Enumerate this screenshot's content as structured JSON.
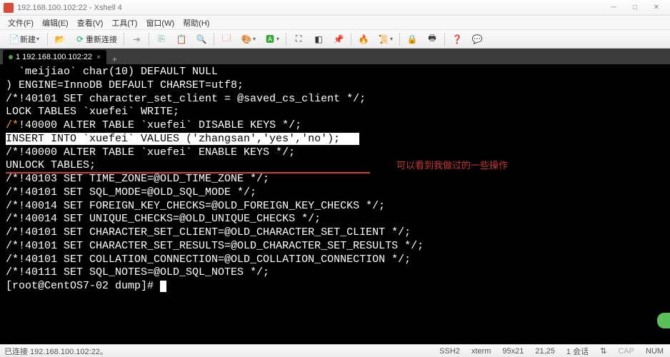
{
  "titlebar": {
    "text": "192.168.100.102:22 - Xshell 4"
  },
  "menubar": [
    {
      "label": "文件(F)"
    },
    {
      "label": "编辑(E)"
    },
    {
      "label": "查看(V)"
    },
    {
      "label": "工具(T)"
    },
    {
      "label": "窗口(W)"
    },
    {
      "label": "帮助(H)"
    }
  ],
  "toolbar": {
    "new_label": "新建",
    "reconnect_label": "重新连接"
  },
  "tabs": [
    {
      "label": "1 192.168.100.102:22"
    }
  ],
  "terminal": {
    "lines": [
      "  `meijiao` char(10) DEFAULT NULL",
      ") ENGINE=InnoDB DEFAULT CHARSET=utf8;",
      "/*!40101 SET character_set_client = @saved_cs_client */;",
      "",
      "",
      "LOCK TABLES `xuefei` WRITE;",
      "/*!40000 ALTER TABLE `xuefei` DISABLE KEYS */;"
    ],
    "highlighted": "INSERT INTO `xuefei` VALUES ('zhangsan','yes','no');",
    "lines_after": [
      "/*!40000 ALTER TABLE `xuefei` ENABLE KEYS */;",
      "UNLOCK TABLES;",
      "/*!40103 SET TIME_ZONE=@OLD_TIME_ZONE */;",
      "",
      "/*!40101 SET SQL_MODE=@OLD_SQL_MODE */;",
      "/*!40014 SET FOREIGN_KEY_CHECKS=@OLD_FOREIGN_KEY_CHECKS */;",
      "/*!40014 SET UNIQUE_CHECKS=@OLD_UNIQUE_CHECKS */;",
      "/*!40101 SET CHARACTER_SET_CLIENT=@OLD_CHARACTER_SET_CLIENT */;",
      "/*!40101 SET CHARACTER_SET_RESULTS=@OLD_CHARACTER_SET_RESULTS */;",
      "/*!40101 SET COLLATION_CONNECTION=@OLD_COLLATION_CONNECTION */;",
      "/*!40111 SET SQL_NOTES=@OLD_SQL_NOTES */;",
      ""
    ],
    "prompt": "[root@CentOS7-02 dump]# ",
    "annotation": "可以看到我做过的一些操作"
  },
  "statusbar": {
    "connected": "已连接 192.168.100.102:22。",
    "ssh": "SSH2",
    "term": "xterm",
    "size": "95x21",
    "pos": "21,25",
    "sessions": "1 会话",
    "cap": "CAP",
    "num": "NUM"
  }
}
